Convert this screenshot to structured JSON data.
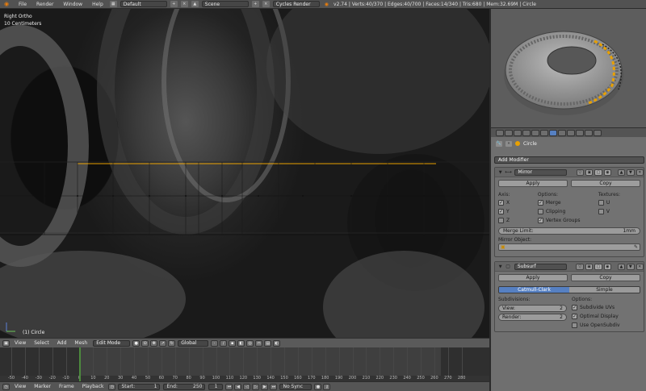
{
  "topbar": {
    "menus": [
      "File",
      "Render",
      "Window",
      "Help"
    ],
    "layout": "Default",
    "scene": "Scene",
    "engine": "Cycles Render",
    "stats": "v2.74 | Verts:40/370 | Edges:40/700 | Faces:14/340 | Tris:680 | Mem:32.69M | Circle"
  },
  "viewport": {
    "view_name": "Right Ortho",
    "scale": "10 Centimeters",
    "active_object": "(1) Circle"
  },
  "vpheader": {
    "menus": [
      "View",
      "Select",
      "Add",
      "Mesh"
    ],
    "mode": "Edit Mode",
    "orientation": "Global"
  },
  "timeline": {
    "ticks": [
      "-50",
      "-40",
      "-30",
      "-20",
      "-10",
      "0",
      "10",
      "20",
      "30",
      "40",
      "50",
      "60",
      "70",
      "80",
      "90",
      "100",
      "110",
      "120",
      "130",
      "140",
      "150",
      "160",
      "170",
      "180",
      "190",
      "200",
      "210",
      "220",
      "230",
      "240",
      "250",
      "260",
      "270",
      "280"
    ]
  },
  "bottombar": {
    "menus": [
      "View",
      "Marker",
      "Frame",
      "Playback"
    ],
    "start": "Start:",
    "start_val": "1",
    "end": "End:",
    "end_val": "250",
    "sync": "No Sync",
    "current": "1"
  },
  "props": {
    "breadcrumb": "Circle",
    "add_modifier": "Add Modifier",
    "mirror": {
      "name": "Mirror",
      "apply": "Apply",
      "copy": "Copy",
      "axis_header": "Axis:",
      "options_header": "Options:",
      "textures_header": "Textures:",
      "axis": [
        "X",
        "Y",
        "Z"
      ],
      "options": [
        "Merge",
        "Clipping",
        "Vertex Groups"
      ],
      "textures": [
        "U",
        "V"
      ],
      "merge_limit_label": "Merge Limit:",
      "merge_limit_value": "1mm",
      "mirror_object_label": "Mirror Object:"
    },
    "subsurf": {
      "name": "Subsurf",
      "apply": "Apply",
      "copy": "Copy",
      "tab_catmull": "Catmull-Clark",
      "tab_simple": "Simple",
      "subdivisions_header": "Subdivisions:",
      "options_header": "Options:",
      "view_label": "View:",
      "view_value": "2",
      "render_label": "Render:",
      "render_value": "2",
      "opt1": "Subdivide UVs",
      "opt2": "Optimal Display",
      "opt3": "Use OpenSubdiv"
    }
  },
  "colors": {
    "accent_blue": "#5680c2",
    "blender_orange": "#e87d0d",
    "timeline_cursor": "#4d8a3e",
    "edge_select": "#e8a000"
  }
}
